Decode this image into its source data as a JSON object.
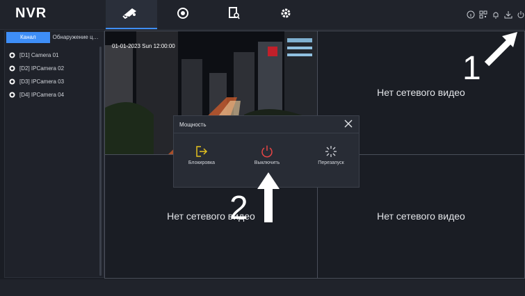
{
  "header": {
    "logo": "NVR",
    "tabs": [
      {
        "icon": "camera-icon",
        "active": true
      },
      {
        "icon": "playback-icon",
        "active": false
      },
      {
        "icon": "file-search-icon",
        "active": false
      },
      {
        "icon": "gear-icon",
        "active": false
      }
    ],
    "right_icons": [
      "info-icon",
      "qr-icon",
      "bell-icon",
      "download-icon",
      "power-icon"
    ],
    "accent": "#3e8ef7"
  },
  "sidebar": {
    "tabs": [
      "Канал",
      "Обнаружение це..."
    ],
    "cameras": [
      "[D1] Camera 01",
      "[D2] IPCamera 02",
      "[D3] IPCamera 03",
      "[D4] IPCamera 04"
    ]
  },
  "grid": {
    "osd_time": "01-01-2023 Sun 12:00:00",
    "no_video": "Нет сетевого видео"
  },
  "dialog": {
    "title": "Мощность",
    "actions": [
      {
        "label": "Блокировка",
        "icon": "logout-icon",
        "color": "#e5c21e"
      },
      {
        "label": "Выключить",
        "icon": "power-icon",
        "color": "#e64545"
      },
      {
        "label": "Перезапуск",
        "icon": "restart-icon",
        "color": "#d5d8de"
      }
    ]
  },
  "annotations": {
    "step1": "1",
    "step2": "2"
  }
}
